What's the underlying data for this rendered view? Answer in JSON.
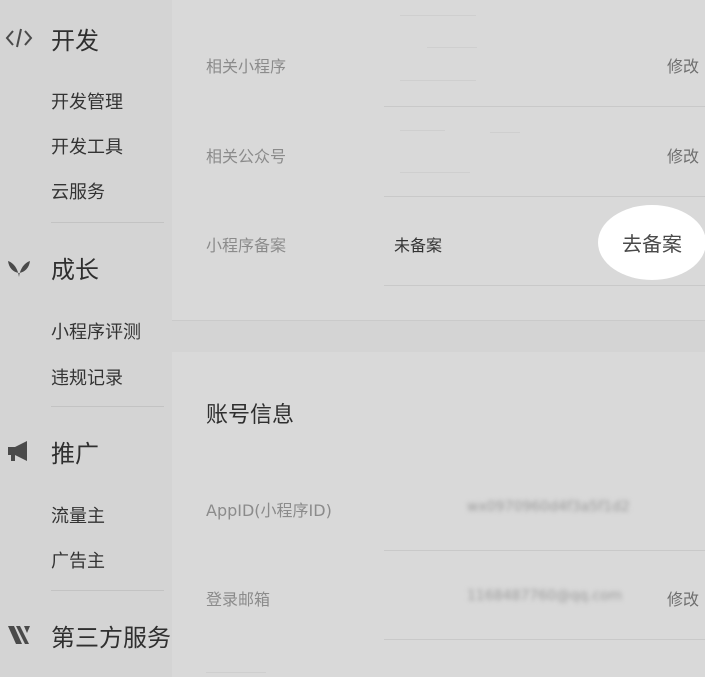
{
  "sidebar": {
    "sections": [
      {
        "title": "开发",
        "icon": "code-icon",
        "items": [
          "开发管理",
          "开发工具",
          "云服务"
        ]
      },
      {
        "title": "成长",
        "icon": "sprout-icon",
        "items": [
          "小程序评测",
          "违规记录"
        ]
      },
      {
        "title": "推广",
        "icon": "megaphone-icon",
        "items": [
          "流量主",
          "广告主"
        ]
      },
      {
        "title": "第三方服务",
        "icon": "third-party-icon",
        "items": []
      }
    ]
  },
  "settings_card": {
    "rows": [
      {
        "label": "相关小程序",
        "value": "",
        "action": "修改"
      },
      {
        "label": "相关公众号",
        "value": "",
        "action": "修改"
      },
      {
        "label": "小程序备案",
        "value": "未备案",
        "action": "去备案"
      }
    ]
  },
  "account_card": {
    "title": "账号信息",
    "rows": [
      {
        "label": "AppID(小程序ID)",
        "value": "wx0970960d4f3a5f1d2",
        "action": ""
      },
      {
        "label": "登录邮箱",
        "value": "1168487760@qq.com",
        "action": "修改"
      }
    ]
  }
}
